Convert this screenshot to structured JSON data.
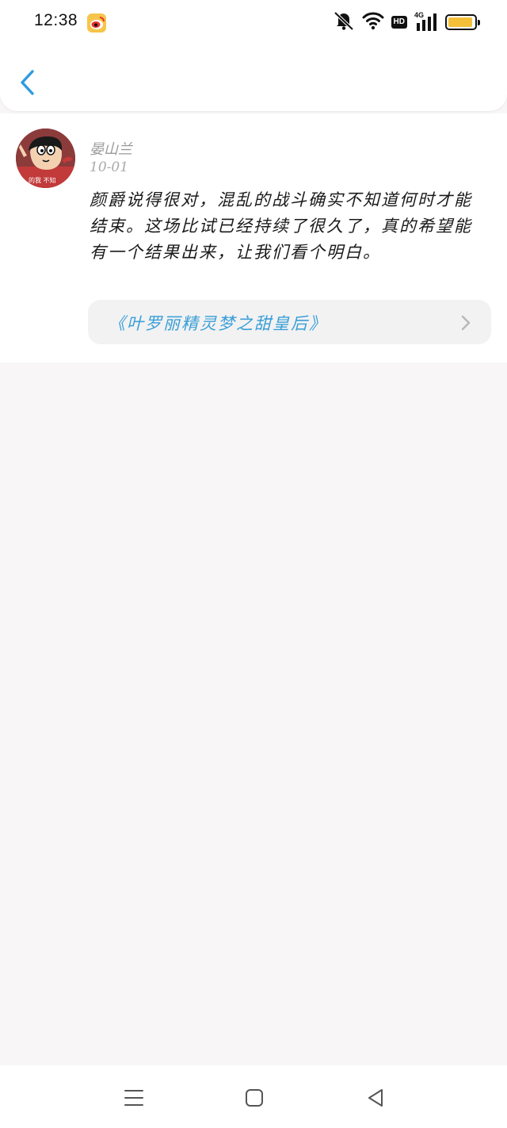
{
  "status_bar": {
    "time": "12:38",
    "hd_label": "HD",
    "network_label": "4G",
    "battery_level": 0.95,
    "icons": [
      "weibo-icon",
      "mute-icon",
      "wifi-icon",
      "hd-icon",
      "signal-icon",
      "battery-icon"
    ]
  },
  "header": {
    "back_icon": "chevron-left-icon"
  },
  "comment": {
    "username": "晏山兰",
    "date": "10-01",
    "text": "颜爵说得很对，混乱的战斗确实不知道何时才能结束。这场比试已经持续了很久了，真的希望能有一个结果出来，让我们看个明白。",
    "avatar_caption": "的我 不知"
  },
  "book_link": {
    "title": "《叶罗丽精灵梦之甜皇后》",
    "icon": "chevron-right-icon"
  },
  "colors": {
    "accent": "#3a9fd6",
    "background": "#f8f6f7",
    "battery": "#f5c038"
  }
}
